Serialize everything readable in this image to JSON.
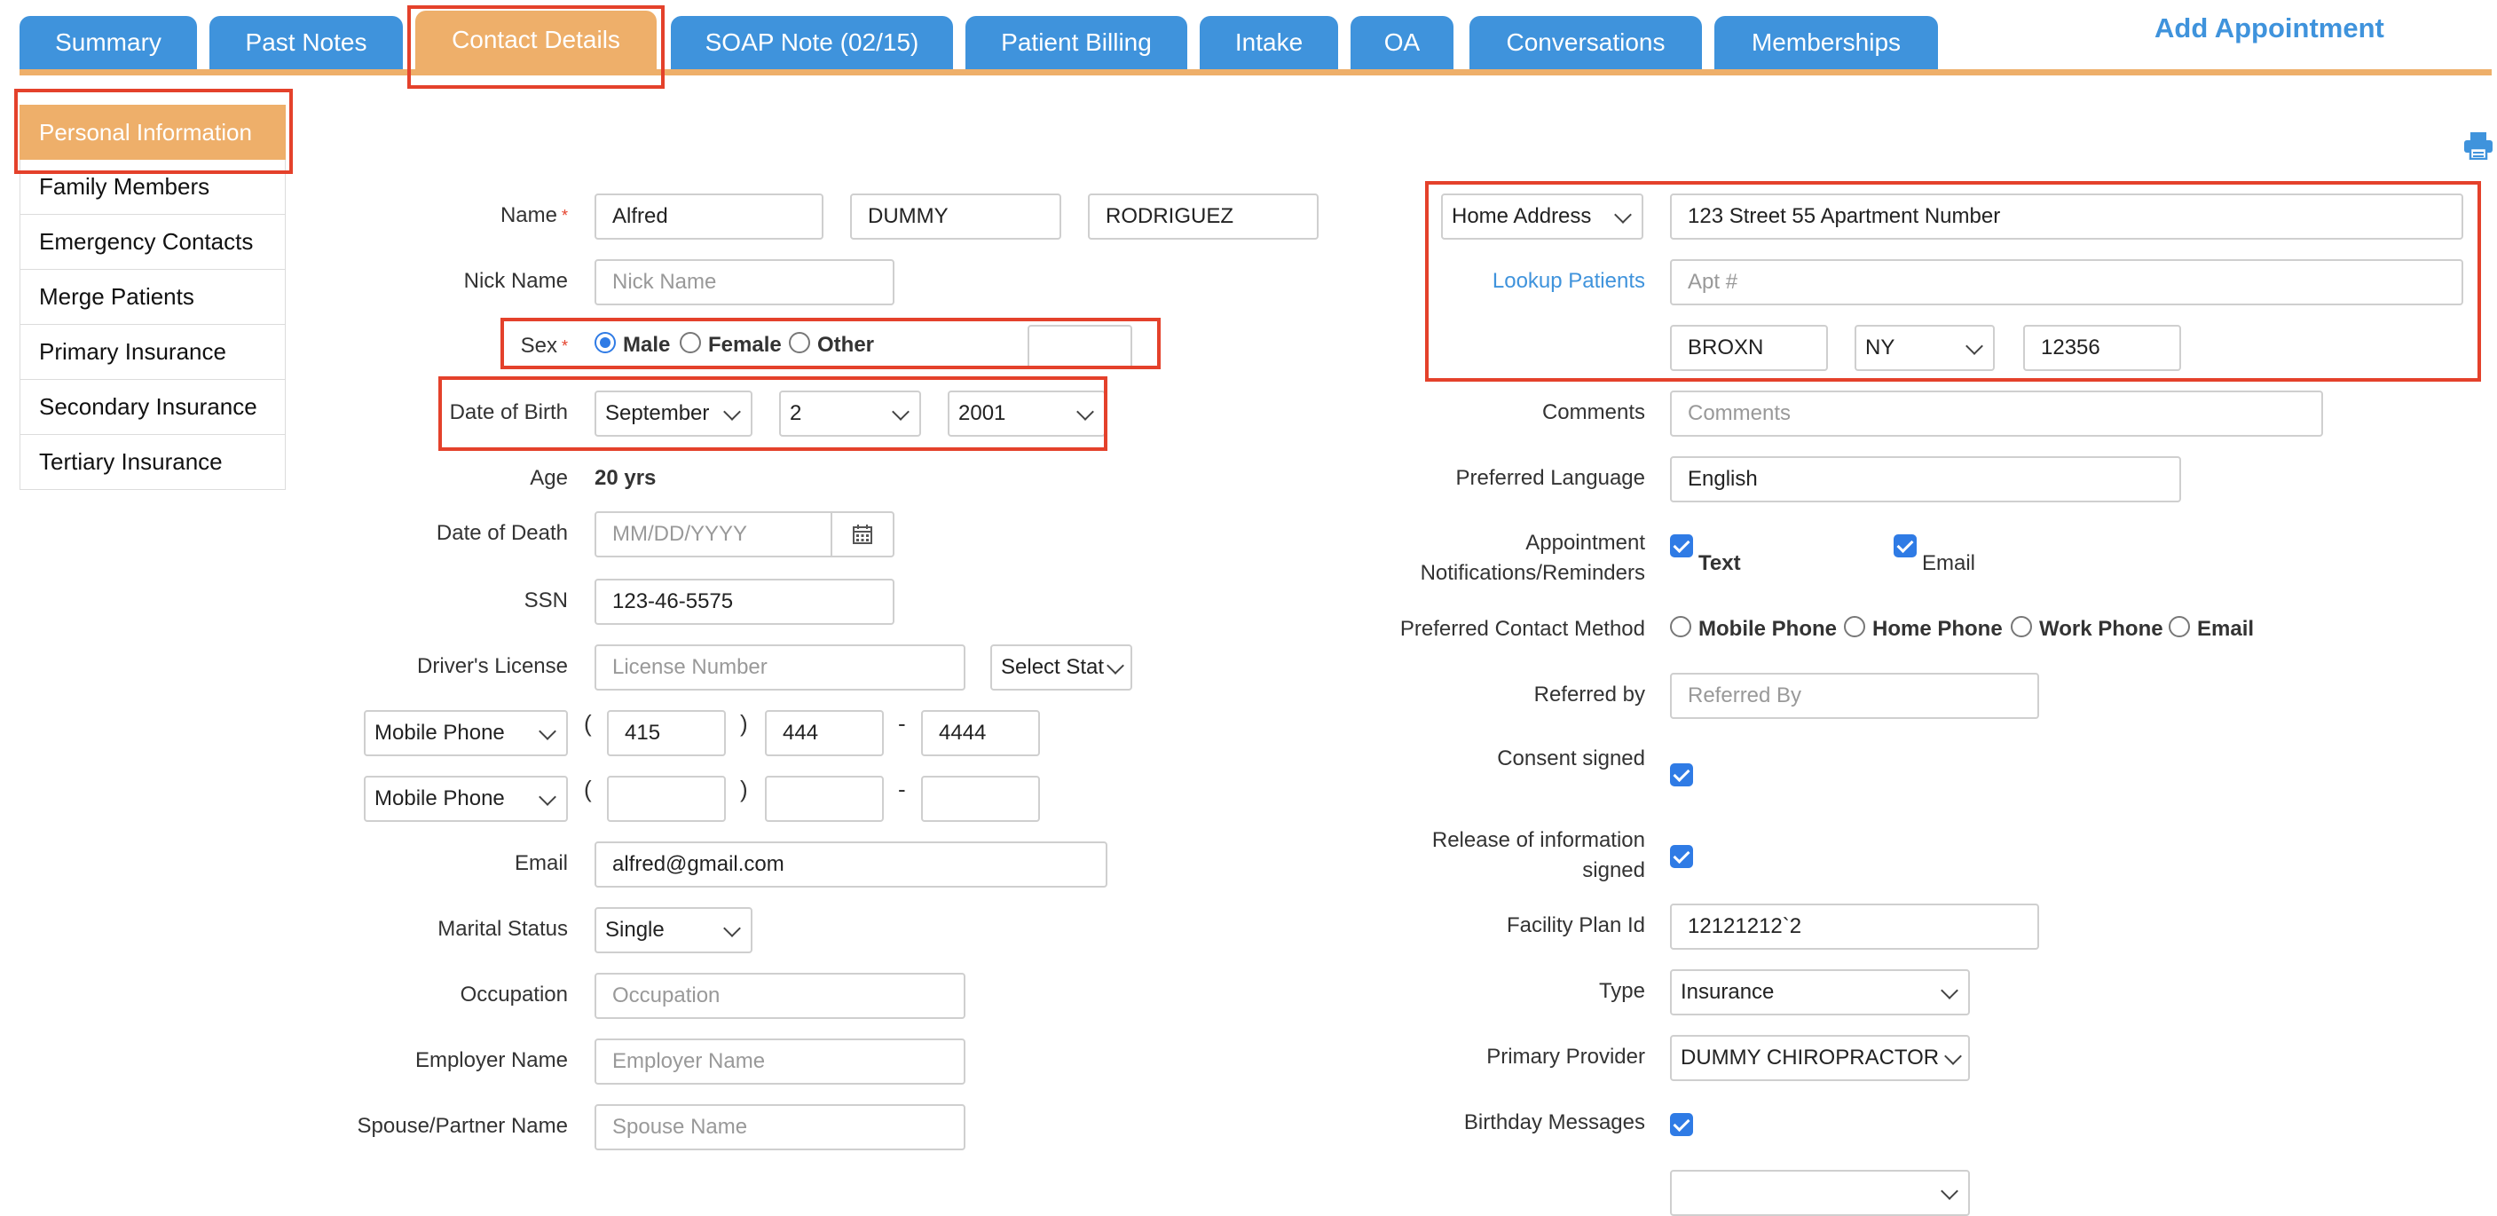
{
  "tabs": [
    "Summary",
    "Past Notes",
    "Contact Details",
    "SOAP Note (02/15)",
    "Patient Billing",
    "Intake",
    "OA",
    "Conversations",
    "Memberships"
  ],
  "add_appointment": "Add Appointment",
  "sidebar": {
    "items": [
      "Personal Information",
      "Family Members",
      "Emergency Contacts",
      "Merge Patients",
      "Primary Insurance",
      "Secondary Insurance",
      "Tertiary Insurance"
    ]
  },
  "left_form": {
    "name_label": "Name",
    "first_name": "Alfred",
    "middle_name": "DUMMY",
    "last_name": "RODRIGUEZ",
    "nick_name_label": "Nick Name",
    "nick_name_placeholder": "Nick Name",
    "sex_label": "Sex",
    "sex_options": [
      "Male",
      "Female",
      "Other"
    ],
    "sex_selected": "Male",
    "dob_label": "Date of Birth",
    "dob_month": "September",
    "dob_day": "2",
    "dob_year": "2001",
    "age_label": "Age",
    "age_value": "20 yrs",
    "dod_label": "Date of Death",
    "dod_placeholder": "MM/DD/YYYY",
    "ssn_label": "SSN",
    "ssn_value": "123-46-5575",
    "license_label": "Driver's License",
    "license_placeholder": "License Number",
    "license_state": "Select Stat",
    "phone1_type": "Mobile Phone",
    "phone1_area": "415",
    "phone1_prefix": "444",
    "phone1_line": "4444",
    "phone2_type": "Mobile Phone",
    "paren_open": "(",
    "paren_close": ")",
    "dash": "-",
    "email_label": "Email",
    "email_value": "alfred@gmail.com",
    "marital_label": "Marital Status",
    "marital_value": "Single",
    "occupation_label": "Occupation",
    "occupation_placeholder": "Occupation",
    "employer_label": "Employer Name",
    "employer_placeholder": "Employer Name",
    "spouse_label": "Spouse/Partner Name",
    "spouse_placeholder": "Spouse Name"
  },
  "right_form": {
    "address_type": "Home Address",
    "address_line1": "123 Street 55 Apartment Number",
    "lookup_patients": "Lookup Patients",
    "apt_placeholder": "Apt #",
    "city": "BROXN",
    "state": "NY",
    "zip": "12356",
    "comments_label": "Comments",
    "comments_placeholder": "Comments",
    "language_label": "Preferred Language",
    "language_value": "English",
    "notif_label_1": "Appointment",
    "notif_label_2": "Notifications/Reminders",
    "notif_text": "Text",
    "notif_email": "Email",
    "contact_method_label": "Preferred Contact Method",
    "contact_methods": [
      "Mobile Phone",
      "Home Phone",
      "Work Phone",
      "Email"
    ],
    "referred_label": "Referred by",
    "referred_placeholder": "Referred By",
    "consent_label": "Consent signed",
    "release_label_1": "Release of information",
    "release_label_2": "signed",
    "facility_label": "Facility Plan Id",
    "facility_value": "12121212`2",
    "type_label": "Type",
    "type_value": "Insurance",
    "provider_label": "Primary Provider",
    "provider_value": "DUMMY CHIROPRACTOR",
    "birthday_label": "Birthday Messages"
  },
  "colors": {
    "tab_blue": "#3f93dc",
    "tab_active": "#eeaf6a",
    "highlight_red": "#e4412b",
    "checkbox_blue": "#2f7be5"
  }
}
